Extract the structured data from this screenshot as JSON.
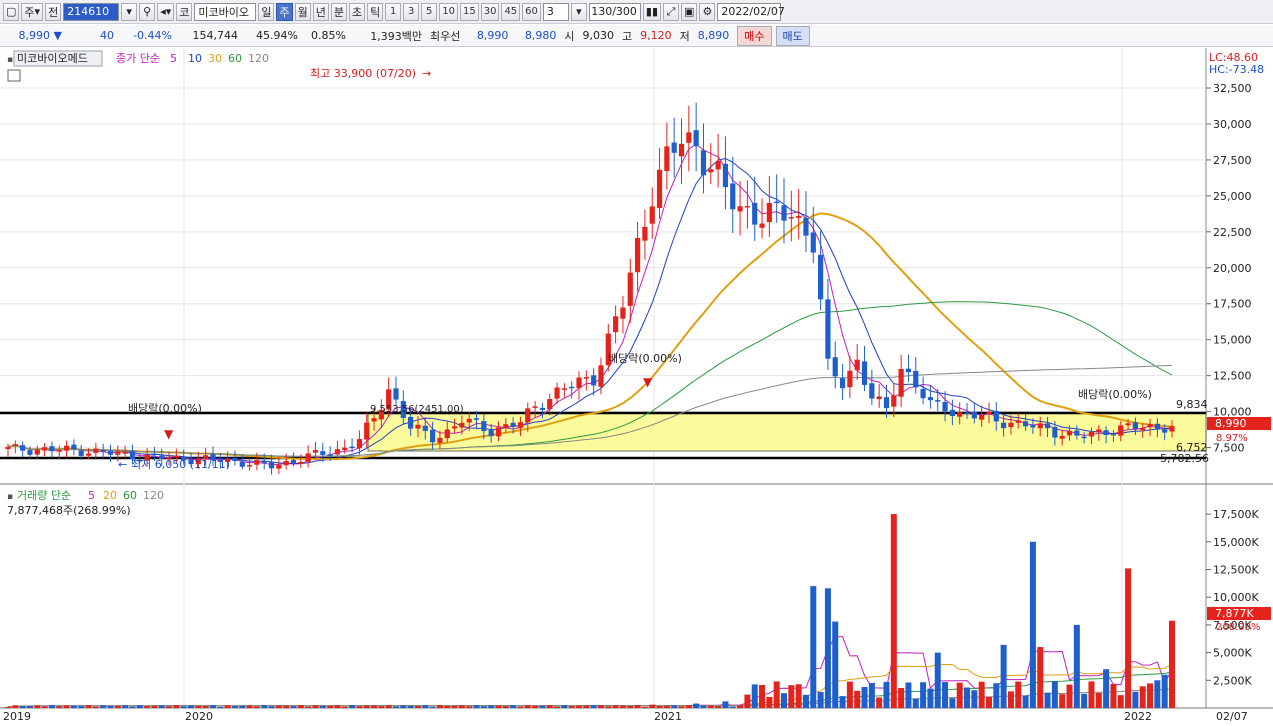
{
  "toolbar": {
    "market": "주",
    "mode": "전",
    "code": "214610",
    "item_button": "코",
    "item_name": "미코바이오",
    "periods": [
      "일",
      "주",
      "월",
      "년",
      "분",
      "초",
      "틱"
    ],
    "active_period": "주",
    "intervals": [
      "1",
      "3",
      "5",
      "10",
      "15",
      "30",
      "45",
      "60"
    ],
    "interval_select": "3",
    "count": "130/300",
    "date": "2022/02/07"
  },
  "quote": {
    "price": "8,990",
    "arrow": "▼",
    "change": "40",
    "change_pct": "-0.44%",
    "volume": "154,744",
    "vol_ratio": "45.94%",
    "turnover_pct": "0.85%",
    "amount": "1,393백만",
    "bid_label": "최우선",
    "bid1": "8,990",
    "bid2": "8,980",
    "open_label": "시",
    "open": "9,030",
    "high_label": "고",
    "high": "9,120",
    "low_label": "저",
    "low": "8,890",
    "buy_label": "매수",
    "sell_label": "매도"
  },
  "price_panel": {
    "name": "미코바이오메드",
    "legend_prefix": "종가 단순",
    "ma_periods": [
      "5",
      "10",
      "30",
      "60",
      "120"
    ],
    "lc": "LC:48.60",
    "hc": "HC:-73.48",
    "high_annotation": "최고 33,900 (07/20)",
    "low_annotation": "최저 6,050 (11/11)",
    "dividend_1": "배당락(0.00%)",
    "dividend_2": "배당락(0.00%)",
    "dividend_3": "배당락(0.00%)",
    "box_label": "9,553.56(2451.00)",
    "level_9834": "9,834",
    "level_6752": "6,752",
    "level_5782": "5,782.56",
    "current_price": "8,990",
    "current_pct": "8.97%",
    "axis_ticks": [
      "32,500",
      "30,000",
      "27,500",
      "25,000",
      "22,500",
      "20,000",
      "17,500",
      "15,000",
      "12,500",
      "10,000",
      "7,500"
    ]
  },
  "volume_panel": {
    "legend_prefix": "거래량 단순",
    "ma_periods": [
      "5",
      "20",
      "60",
      "120"
    ],
    "current_value": "7,877,468주(268.99%)",
    "current_tag": "7,877K",
    "current_pct": "268.99%",
    "axis_ticks": [
      "17,500K",
      "15,000K",
      "12,500K",
      "10,000K",
      "7,500K",
      "5,000K",
      "2,500K"
    ]
  },
  "x_axis": {
    "labels": [
      "2019",
      "2020",
      "2021",
      "2022"
    ],
    "end_label": "02/07"
  },
  "colors": {
    "up": "#e3231c",
    "down": "#1f5fcc",
    "ma5": "#c020c0",
    "ma10": "#2040c0",
    "ma30": "#e0a010",
    "ma60": "#2a9a40",
    "ma120": "#888888",
    "box_fill": "#fbfb9c"
  },
  "chart_data": {
    "type": "candlestick",
    "period": "weekly",
    "x": [
      "2019-01",
      "2020-01",
      "2021-01",
      "2022-01",
      "2022-02-07"
    ],
    "price_ylim": [
      5000,
      34000
    ],
    "volume_ylim": [
      0,
      18500000
    ],
    "key_points": {
      "all_time_high": 33900,
      "all_time_low": 6050,
      "last_close": 8990,
      "last_volume": 7877468
    },
    "series": [
      {
        "name": "종가 단순 5"
      },
      {
        "name": "10"
      },
      {
        "name": "30"
      },
      {
        "name": "60"
      },
      {
        "name": "120"
      }
    ]
  }
}
